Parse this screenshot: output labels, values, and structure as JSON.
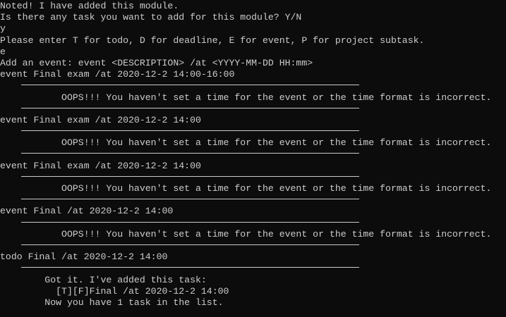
{
  "terminal": {
    "lines": [
      {
        "kind": "text",
        "text": "Noted! I have added this module."
      },
      {
        "kind": "text",
        "text": "Is there any task you want to add for this module? Y/N"
      },
      {
        "kind": "text",
        "text": "y"
      },
      {
        "kind": "text",
        "text": "Please enter T for todo, D for deadline, E for event, P for project subtask."
      },
      {
        "kind": "text",
        "text": "e"
      },
      {
        "kind": "text",
        "text": "Add an event: event <DESCRIPTION> /at <YYYY-MM-DD HH:mm>"
      },
      {
        "kind": "text",
        "text": "event Final exam /at 2020-12-2 14:00-16:00"
      },
      {
        "kind": "separator"
      },
      {
        "kind": "text",
        "text": "           OOPS!!! You haven't set a time for the event or the time format is incorrect."
      },
      {
        "kind": "separator"
      },
      {
        "kind": "text",
        "text": "event Final exam /at 2020-12-2 14:00"
      },
      {
        "kind": "separator"
      },
      {
        "kind": "text",
        "text": "           OOPS!!! You haven't set a time for the event or the time format is incorrect."
      },
      {
        "kind": "separator"
      },
      {
        "kind": "text",
        "text": "event Final exam /at 2020-12-2 14:00"
      },
      {
        "kind": "separator"
      },
      {
        "kind": "text",
        "text": "           OOPS!!! You haven't set a time for the event or the time format is incorrect."
      },
      {
        "kind": "separator"
      },
      {
        "kind": "text",
        "text": "event Final /at 2020-12-2 14:00"
      },
      {
        "kind": "separator"
      },
      {
        "kind": "text",
        "text": "           OOPS!!! You haven't set a time for the event or the time format is incorrect."
      },
      {
        "kind": "separator"
      },
      {
        "kind": "text",
        "text": "todo Final /at 2020-12-2 14:00"
      },
      {
        "kind": "separator"
      },
      {
        "kind": "text",
        "text": "        Got it. I've added this task:"
      },
      {
        "kind": "text",
        "text": "          [T][F]Final /at 2020-12-2 14:00"
      },
      {
        "kind": "text",
        "text": "        Now you have 1 task in the list."
      }
    ]
  }
}
